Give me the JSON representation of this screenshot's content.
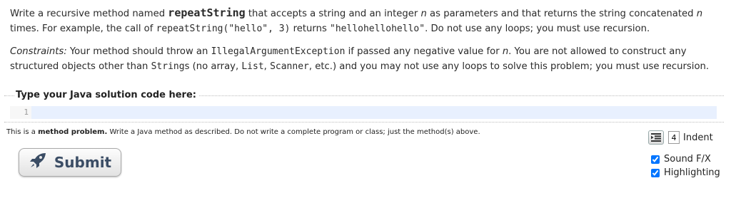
{
  "prompt": {
    "p1_a": "Write a recursive method named ",
    "method_name": "repeatString",
    "p1_b": " that accepts a string and an integer ",
    "n1": "n",
    "p1_c": " as parameters and that returns the string concatenated ",
    "n2": "n",
    "p1_d": " times. For example, the call of ",
    "example_call": "repeatString(\"hello\", 3)",
    "p1_e": " returns ",
    "example_result": "\"hellohellohello\"",
    "p1_f": ". Do not use any loops; you must use recursion.",
    "constraints_label": "Constraints:",
    "p2_a": " Your method should throw an ",
    "exception": "IllegalArgumentException",
    "p2_b": " if passed any negative value for ",
    "n3": "n",
    "p2_c": ". You are not allowed to construct any structured objects other than ",
    "strings": "String",
    "p2_d": "s (no array, ",
    "list": "List",
    "p2_e": ", ",
    "scanner": "Scanner",
    "p2_f": ", etc.) and you may not use any loops to solve this problem; you must use recursion."
  },
  "editor": {
    "legend": "Type your Java solution code here:",
    "line_number": "1",
    "code": ""
  },
  "note": {
    "a": "This is a ",
    "bold": "method problem.",
    "b": " Write a Java method as described. Do not write a complete program or class; just the method(s) above."
  },
  "submit_label": "Submit",
  "controls": {
    "indent_value": "4",
    "indent_label": "Indent",
    "sound_label": "Sound F/X",
    "highlighting_label": "Highlighting",
    "sound_checked": true,
    "highlighting_checked": true
  },
  "colors": {
    "editor_line": "#e8f0fe",
    "submit_text": "#3b4d65"
  }
}
